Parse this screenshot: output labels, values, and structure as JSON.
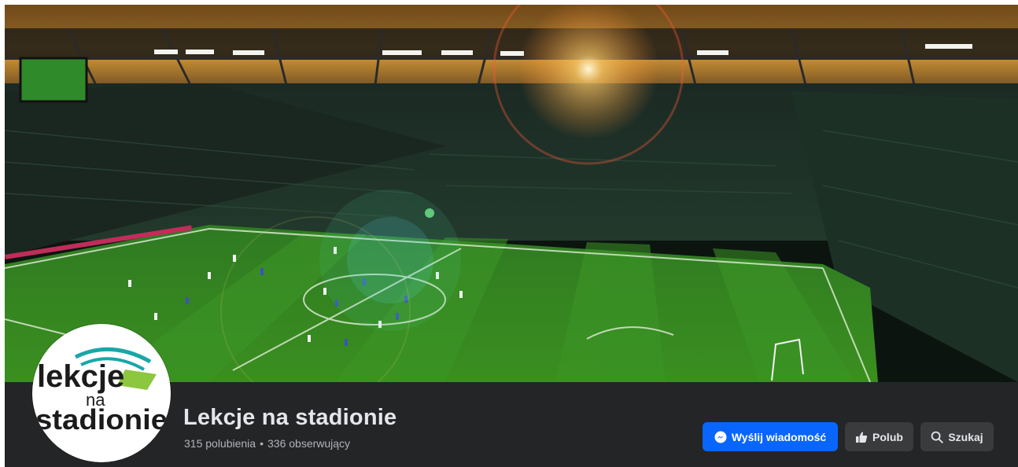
{
  "page": {
    "name": "Lekcje na stadionie",
    "likes": "315 polubienia",
    "separator": "•",
    "followers": "336 obserwujący"
  },
  "avatar_logo": {
    "line1": "lekcje",
    "line2": "na",
    "line3": "stadionie",
    "colors": {
      "teal": "#1aa6a8",
      "green": "#8dc63f",
      "text": "#1b1b1b"
    }
  },
  "actions": {
    "message_label": "Wyślij wiadomość",
    "like_label": "Polub",
    "search_label": "Szukaj"
  },
  "icons": {
    "message": "messenger-icon",
    "like": "thumbs-up-icon",
    "search": "search-icon"
  },
  "colors": {
    "accent": "#0866ff",
    "bar_bg": "#242526",
    "button_bg": "#3a3b3c"
  }
}
